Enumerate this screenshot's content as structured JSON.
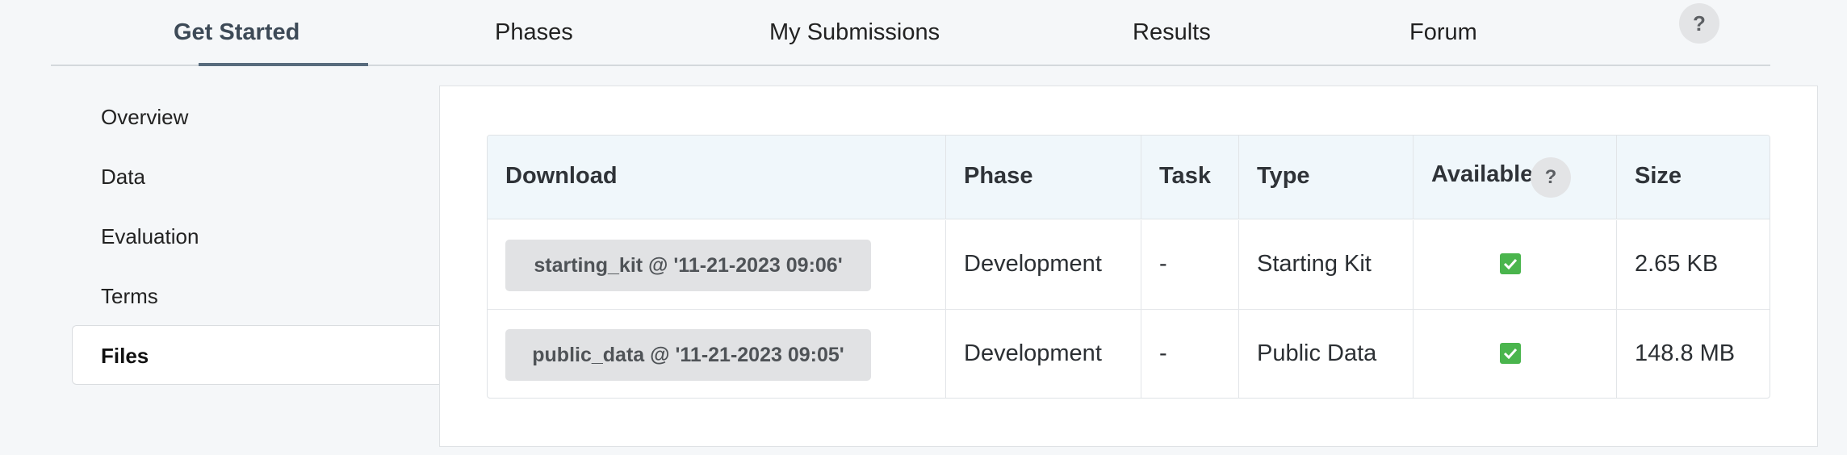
{
  "topnav": {
    "tabs": [
      {
        "label": "Get Started"
      },
      {
        "label": "Phases"
      },
      {
        "label": "My Submissions"
      },
      {
        "label": "Results"
      },
      {
        "label": "Forum"
      }
    ],
    "help": "?"
  },
  "sidemenu": {
    "items": [
      {
        "label": "Overview"
      },
      {
        "label": "Data"
      },
      {
        "label": "Evaluation"
      },
      {
        "label": "Terms"
      },
      {
        "label": "Files"
      }
    ],
    "active": "Files"
  },
  "files_table": {
    "headers": {
      "download": "Download",
      "phase": "Phase",
      "task": "Task",
      "type": "Type",
      "available": "Available",
      "available_help": "?",
      "size": "Size"
    },
    "rows": [
      {
        "download": "starting_kit @ '11-21-2023 09:06'",
        "phase": "Development",
        "task": "-",
        "type": "Starting Kit",
        "available": true,
        "size": "2.65 KB"
      },
      {
        "download": "public_data @ '11-21-2023 09:05'",
        "phase": "Development",
        "task": "-",
        "type": "Public Data",
        "available": true,
        "size": "148.8 MB"
      }
    ]
  },
  "colors": {
    "accent": "#586b7d",
    "header_bg": "#f0f7fb",
    "check_green": "#4ab54d",
    "button_bg": "#e1e2e4"
  }
}
